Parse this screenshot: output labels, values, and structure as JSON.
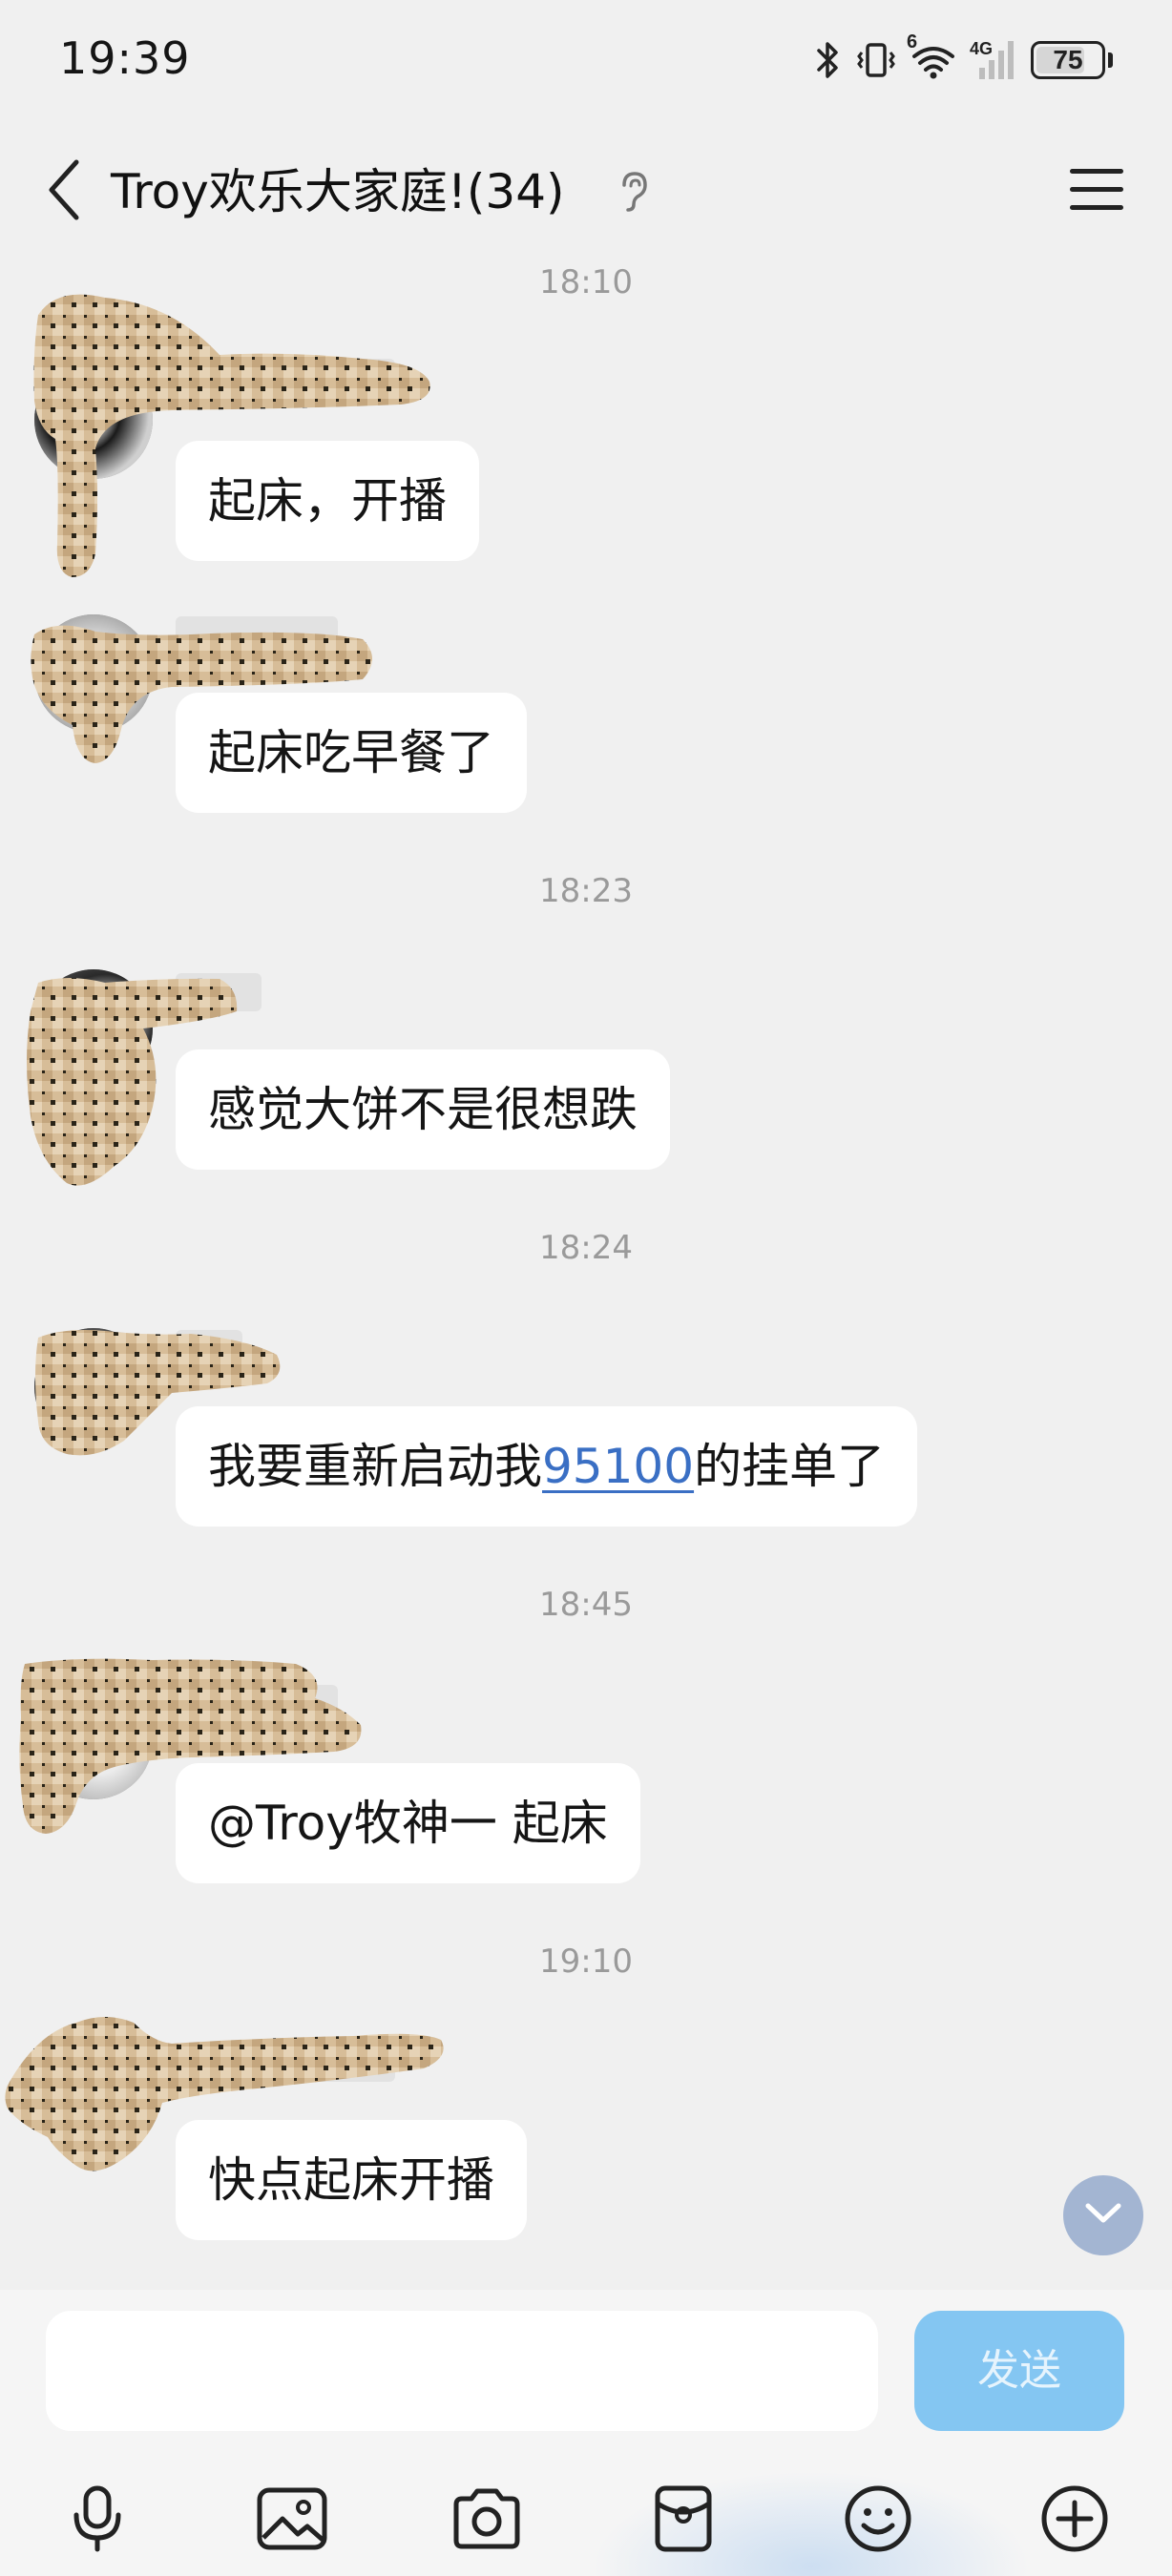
{
  "status_bar": {
    "time": "19:39",
    "network_label": "4G",
    "signal_superscript": "6",
    "battery_level": "75",
    "battery_fraction": 0.75
  },
  "header": {
    "title": "Troy欢乐大家庭!(34)",
    "back_icon": "chevron-left-icon",
    "ear_icon": "ear-icon",
    "menu_icon": "hamburger-menu-icon"
  },
  "messages": [
    {
      "type": "timestamp",
      "text": "18:10"
    },
    {
      "type": "message",
      "text": "起床，开播"
    },
    {
      "type": "message",
      "text": "起床吃早餐了"
    },
    {
      "type": "timestamp",
      "text": "18:23"
    },
    {
      "type": "message",
      "text": "感觉大饼不是很想跌"
    },
    {
      "type": "timestamp",
      "text": "18:24"
    },
    {
      "type": "message",
      "text_before": "我要重新启动我",
      "link": "95100",
      "text_after": "的挂单了"
    },
    {
      "type": "timestamp",
      "text": "18:45"
    },
    {
      "type": "message",
      "text": "@Troy牧神一 起床"
    },
    {
      "type": "timestamp",
      "text": "19:10"
    },
    {
      "type": "message",
      "text": "快点起床开播"
    }
  ],
  "input": {
    "value": "",
    "placeholder": "",
    "send_label": "发送"
  },
  "toolbar": {
    "icons": [
      "microphone-icon",
      "image-icon",
      "camera-icon",
      "red-packet-icon",
      "emoji-icon",
      "plus-icon"
    ]
  },
  "colors": {
    "background": "#f0f0f0",
    "bubble": "#ffffff",
    "timestamp": "#9a9a9a",
    "link": "#3a6fc4",
    "send_button": "#84c6f2",
    "scroll_button": "#a3b5d2"
  }
}
